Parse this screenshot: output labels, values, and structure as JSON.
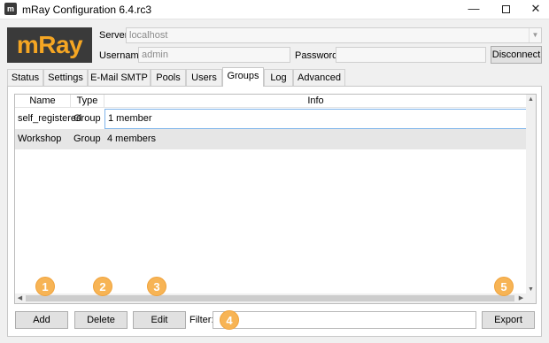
{
  "window": {
    "title": "mRay Configuration 6.4.rc3",
    "minimize": "—",
    "close": "✕"
  },
  "logo": "mRay",
  "connection": {
    "server_label": "Server:",
    "server_value": "localhost",
    "username_label": "Username:",
    "username_value": "admin",
    "password_label": "Password:",
    "password_value": "",
    "disconnect_label": "Disconnect"
  },
  "tabs": [
    "Status",
    "Settings",
    "E-Mail SMTP",
    "Pools",
    "Users",
    "Groups",
    "Log",
    "Advanced"
  ],
  "active_tab": "Groups",
  "table": {
    "columns": [
      "Name",
      "Type",
      "Info"
    ],
    "rows": [
      {
        "name": "self_registered",
        "type": "Group",
        "info": "1 member"
      },
      {
        "name": "Workshop",
        "type": "Group",
        "info": "4 members"
      }
    ]
  },
  "toolbar": {
    "add_label": "Add",
    "delete_label": "Delete",
    "edit_label": "Edit",
    "filter_label": "Filter:",
    "filter_value": "",
    "export_label": "Export"
  },
  "callouts": [
    "1",
    "2",
    "3",
    "4",
    "5"
  ],
  "colors": {
    "logo_background": "#3a3a3a",
    "logo_text": "#f5a623",
    "callout": "#f7b455",
    "selected_cell_border": "#7eb4ea",
    "row_highlight": "#e6e6e6"
  }
}
